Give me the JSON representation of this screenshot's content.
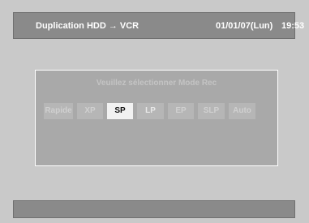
{
  "header": {
    "title": "Duplication HDD → VCR",
    "date": "01/01/07(Lun)",
    "time": "19:53"
  },
  "dialog": {
    "prompt": "Veuillez sélectionner Mode Rec",
    "modes": [
      {
        "label": "Rapide",
        "selected": false
      },
      {
        "label": "XP",
        "selected": false
      },
      {
        "label": "SP",
        "selected": true
      },
      {
        "label": "LP",
        "selected": false
      },
      {
        "label": "EP",
        "selected": false
      },
      {
        "label": "SLP",
        "selected": false
      },
      {
        "label": "Auto",
        "selected": false
      }
    ]
  },
  "footer": {
    "text": ""
  }
}
